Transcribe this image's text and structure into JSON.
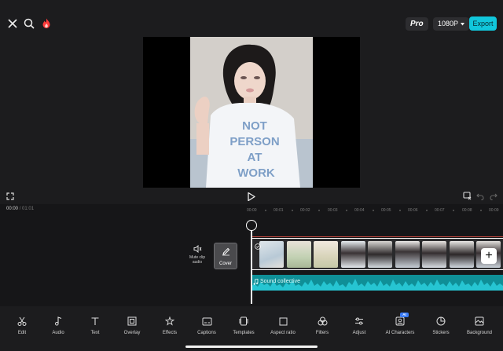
{
  "header": {
    "pro_label": "Pro",
    "resolution_label": "1080P",
    "export_label": "Export"
  },
  "preview": {
    "shirt_lines": [
      "NOT",
      "PERSON",
      "AT",
      "WORK"
    ]
  },
  "timeline": {
    "current_time": "00:00",
    "total_time": "01:01",
    "ruler_labels": [
      "00:00",
      "00:01",
      "00:02",
      "00:03",
      "00:04",
      "00:05",
      "00:06",
      "00:07",
      "00:08",
      "00:09"
    ],
    "mute_label": "Mute clip audio",
    "cover_label": "Cover",
    "audio_track_label": "Sound collective",
    "add_label": "+"
  },
  "toolbar": {
    "ai_badge": "AI",
    "items": [
      {
        "label": "Edit",
        "icon": "scissors-icon"
      },
      {
        "label": "Audio",
        "icon": "music-note-icon"
      },
      {
        "label": "Text",
        "icon": "text-icon"
      },
      {
        "label": "Overlay",
        "icon": "overlay-icon"
      },
      {
        "label": "Effects",
        "icon": "effects-icon"
      },
      {
        "label": "Captions",
        "icon": "captions-icon"
      },
      {
        "label": "Templates",
        "icon": "templates-icon"
      },
      {
        "label": "Aspect ratio",
        "icon": "aspect-ratio-icon"
      },
      {
        "label": "Filters",
        "icon": "filters-icon"
      },
      {
        "label": "Adjust",
        "icon": "adjust-icon"
      },
      {
        "label": "AI Characters",
        "icon": "ai-characters-icon"
      },
      {
        "label": "Stickers",
        "icon": "stickers-icon"
      },
      {
        "label": "Background",
        "icon": "background-icon"
      }
    ]
  },
  "colors": {
    "accent": "#11c7dc",
    "background": "#1c1c1e",
    "audio_track": "#0f8f97",
    "flame": "#ff3b3b"
  }
}
